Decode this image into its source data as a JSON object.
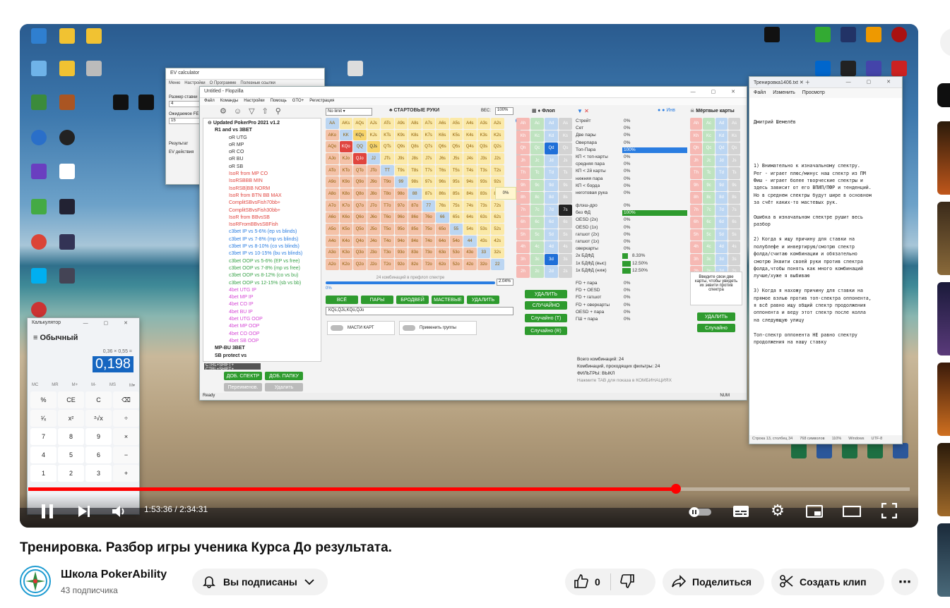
{
  "video": {
    "title": "Тренировка. Разбор игры ученика Курса До результата.",
    "time_current": "1:53:36",
    "time_total": "2:34:31",
    "time_separator": "/",
    "progress_fraction": 0.735,
    "accent": "#ff0000"
  },
  "channel": {
    "name": "Школа PokerAbility",
    "subscribers": "43 подписчика"
  },
  "actions": {
    "subscribed_label": "Вы подписаны",
    "like_count": "0",
    "share_label": "Поделиться",
    "clip_label": "Создать клип"
  },
  "screen": {
    "calculator": {
      "title": "Калькулятор",
      "mode": "Обычный",
      "expression": "0,36 × 0,55 =",
      "result": "0,198",
      "keys": [
        "%",
        "CE",
        "C",
        "⌫",
        "¹⁄ₓ",
        "x²",
        "²√x",
        "÷",
        "7",
        "8",
        "9",
        "×",
        "4",
        "5",
        "6",
        "−",
        "1",
        "2",
        "3",
        "+"
      ],
      "memory": [
        "MC",
        "MR",
        "M+",
        "M-",
        "MS",
        "M▾"
      ]
    },
    "flopzilla": {
      "title": "Untitled - Flopzilla",
      "menu": [
        "Файл",
        "Команды",
        "Настройки",
        "Помощь",
        "GTO+",
        "Регистрация"
      ],
      "limit": "No limit",
      "starting_hands_label": "СТАРТОВЫЕ РУКИ",
      "weight_label": "ВЕС:",
      "weight_value": "100%",
      "flop_label": "Флоп",
      "dead_cards_label": "Мёртвые карты",
      "combos_note": "24 комбинаций в префлоп спектре",
      "percent_value": "2.04%",
      "zero_percent": "0%",
      "range_text": "KQs,QJs,KQo,QJo",
      "buttons_row": [
        "ВСЁ",
        "ПАРЫ",
        "БРОДВЕЙ",
        "МАСТЕВЫЕ",
        "УДАЛИТЬ"
      ],
      "suit_toggle": "МАСТИ КАРТ",
      "groups_toggle": "Применить группы",
      "add_spectrum": "ДОБ. СПЕКТР",
      "add_folder": "ДОБ. ПАПКУ",
      "rename": "Переименов.",
      "delete": "Удалить",
      "shortcuts": "CTRL+SHIFT+ CTRL+SHIFT+",
      "status": "Ready",
      "status_right": "NUM",
      "flop_buttons": [
        "УДАЛИТЬ",
        "СЛУЧАЙНО",
        "Случайно (T)",
        "Случайно (R)"
      ],
      "dead_buttons": [
        "УДАЛИТЬ",
        "Случайно"
      ],
      "dead_hint": "Введите свои две карты, чтобы увидеть их эквити против спектра",
      "total_combos": "Всего комбинаций: 24",
      "passing_combos": "Комбинаций, проходящих фильтры: 24",
      "filters": "ФИЛЬТРЫ: ВЫКЛ",
      "tab_hint": "Нажмите TAB для показа в КОМБИНАЦИЯХ",
      "tree_root": "Updated PokerPro 2021 v1.2",
      "tree_items": [
        "R1 and vs 3BET",
        "oR UTG",
        "oR MP",
        "oR CO",
        "oR BU",
        "oR SB",
        "IsoR from MP CO",
        "IsoRSBBB MIN",
        "IsoRSB|BB NORM",
        "IsoR from BTN BB MAX",
        "ComplitSBvsFish70bb+",
        "ComplitSBvsFish30bb+",
        "IsoR from BBvsSB",
        "IsoRFromBBvsSBFish",
        "c3bet IP vs 5-6% (ep vs blinds)",
        "c3bet IP vs 7-8% (mp vs blinds)",
        "c3bet IP vs 8-10% (co vs blinds)",
        "c3bet IP vs 10-15% (bu vs blinds)",
        "c3bet OOP vs 5-6% (EP vs free)",
        "c3bet OOP vs 7-8% (mp vs free)",
        "c3bet OOP vs 8-12% (co vs bu)",
        "c3bet OOP vs 12-15% (sb vs bb)",
        "4bet UTG IP",
        "4bet MP IP",
        "4bet CO IP",
        "4bet BU IP",
        "4bet UTG OOP",
        "4bet MP OOP",
        "4bet CO OOP",
        "4bet SB OOP",
        "MP-BU 3BET",
        "SB protect vs"
      ],
      "stats": [
        {
          "name": "Стрейт",
          "pct": "0%",
          "fill": 0
        },
        {
          "name": "Сет",
          "pct": "0%",
          "fill": 0
        },
        {
          "name": "Две пары",
          "pct": "0%",
          "fill": 0
        },
        {
          "name": "Оверпара",
          "pct": "0%",
          "fill": 0
        },
        {
          "name": "Топ-Пара",
          "pct": "100%",
          "fill": 1
        },
        {
          "name": "КП < топ-карты",
          "pct": "0%",
          "fill": 0
        },
        {
          "name": "средняя пара",
          "pct": "0%",
          "fill": 0
        },
        {
          "name": "КП < 2й карты",
          "pct": "0%",
          "fill": 0
        },
        {
          "name": "нижняя пара",
          "pct": "0%",
          "fill": 0
        },
        {
          "name": "КП < борда",
          "pct": "0%",
          "fill": 0
        },
        {
          "name": "неготовая рука",
          "pct": "0%",
          "fill": 0
        },
        {
          "name": "флэш-дро",
          "pct": "0%",
          "fill": 0
        },
        {
          "name": "без ФД",
          "pct": "100%",
          "fill": 1
        },
        {
          "name": "OESD (2x)",
          "pct": "0%",
          "fill": 0
        },
        {
          "name": "OESD (1x)",
          "pct": "0%",
          "fill": 0
        },
        {
          "name": "гатшот (2x)",
          "pct": "0%",
          "fill": 0
        },
        {
          "name": "гатшот (1x)",
          "pct": "0%",
          "fill": 0
        },
        {
          "name": "оверкарты",
          "pct": "0%",
          "fill": 0
        },
        {
          "name": "2к БДФД",
          "pct": "8.33%",
          "fill": 0.0833
        },
        {
          "name": "1к БДФД (выс)",
          "pct": "12.50%",
          "fill": 0.125
        },
        {
          "name": "1к БДФД (ниж)",
          "pct": "12.50%",
          "fill": 0.125
        },
        {
          "name": "FD + пара",
          "pct": "0%",
          "fill": 0
        },
        {
          "name": "FD + OESD",
          "pct": "0%",
          "fill": 0
        },
        {
          "name": "FD + гатшот",
          "pct": "0%",
          "fill": 0
        },
        {
          "name": "FD + оверкарты",
          "pct": "0%",
          "fill": 0
        },
        {
          "name": "OESD + пара",
          "pct": "0%",
          "fill": 0
        },
        {
          "name": "ГШ + пара",
          "pct": "0%",
          "fill": 0
        }
      ],
      "flop_cards": [
        "Qd",
        "7s",
        "3d"
      ]
    },
    "notepad": {
      "title": "Тренировка1406.txt",
      "menu": [
        "Файл",
        "Изменить",
        "Просмотр"
      ],
      "author": "Дмитрий Шемелёв",
      "lines": [
        "1) Внимательно к изначальному спектру.",
        "Рег - играет плюс/минус наш спектр из ПМ",
        "Фиш - играет более творческие спектры и",
        "здесь зависит от его ВПИП/ПФР и тенденций.",
        "Но в среднем спектры будут шире в основном",
        "за счёт каких-то мастевых рук.",
        "",
        "Ошибка в изначальном спектре рушит весь",
        "разбор",
        "",
        "2) Когда я ищу причину для ставки на",
        "полублефе и инвертирую/смотрю спектр",
        "фолда/считаю комбинации и обязательно",
        "смотрю Эквити своей руки против спектра",
        "фолда,чтобы понять как много комбинаций",
        "лучше/хуже я выбиваю",
        "",
        "3) Когда я нахожу причину для ставки на",
        "прямое вэлью против топ-спектра оппонента,",
        "я всё равно ищу общий спектр продолжения",
        "оппонента и веду этот спектр после колла",
        "на следующую улицу",
        "",
        "Топ-спектр оппонента НЕ равно спектру",
        "продолжения на нашу ставку"
      ],
      "status": [
        "Строка 13, столбец 34",
        "768 символов",
        "110%",
        "Windows",
        "UTF-8"
      ]
    },
    "ev_calc": {
      "title": "EV calculator",
      "menu": [
        "Меню",
        "Настройки",
        "О Программе",
        "Полезные ссылки"
      ],
      "field1_label": "Размер ставки",
      "field1_value": "4",
      "field2_label": "Ожидаемое FE",
      "field2_value": "15",
      "result_label": "Результат",
      "ev_label": "EV действия"
    }
  }
}
